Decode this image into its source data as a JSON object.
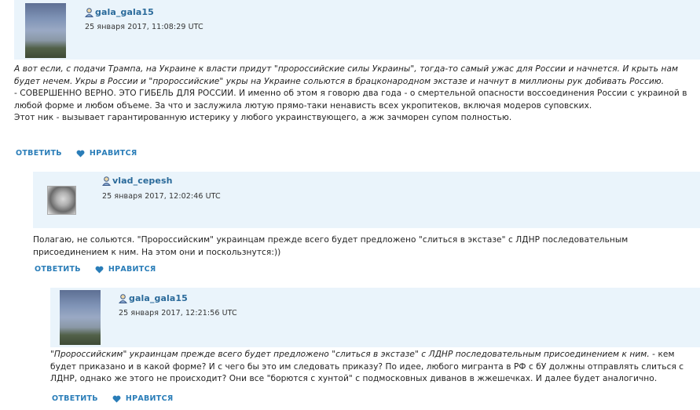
{
  "colors": {
    "header_bg": "#eaf4fb",
    "username": "#2a6a9a",
    "action": "#2a7db8"
  },
  "comments": [
    {
      "username": "gala_gala15",
      "date": "25 января 2017, 11:08:29 UTC",
      "avatar": "sky-photo",
      "paragraphs": [
        {
          "text": "А вот если, с подачи Трампа, на Украине к власти придут \"пророссийские силы Украины\", тогда-то самый ужас для России и начнется. И крыть нам будет нечем. Укры в России и \"пророссийские\" укры на Украине сольются в брацконародном экстазе и начнут в миллионы рук добивать Россию.",
          "italic": true
        },
        {
          "text": "- СОВЕРШЕННО ВЕРНО. ЭТО ГИБЕЛЬ ДЛЯ РОССИИ. И именно об этом я говорю два года - о смертельной опасности воссоединения России с украиной в любой форме и любом объеме. За что и заслужила лютую прямо-таки ненависть всех укропитеков, включая модеров суповских.",
          "italic": false
        },
        {
          "text": "Этот ник - вызывает гарантированную истерику у любого украинствующего, а жж зачморен супом полностью.",
          "italic": false
        }
      ],
      "reply_label": "ОТВЕТИТЬ",
      "like_label": "НРАВИТСЯ"
    },
    {
      "username": "vlad_cepesh",
      "date": "25 января 2017, 12:02:46 UTC",
      "avatar": "portrait-photo",
      "paragraphs": [
        {
          "text": "Полагаю, не сольются. \"Пророссийским\" украинцам прежде всего будет предложено \"слиться в экстазе\" с ЛДНР последовательным присоединением к ним. На этом они и поскользнутся:))",
          "italic": false
        }
      ],
      "reply_label": "ОТВЕТИТЬ",
      "like_label": "НРАВИТСЯ"
    },
    {
      "username": "gala_gala15",
      "date": "25 января 2017, 12:21:56 UTC",
      "avatar": "sky-photo",
      "paragraphs": [
        {
          "text": "\"Пророссийским\" украинцам прежде всего будет предложено \"слиться в экстазе\" с ЛДНР последовательным присоединением к ним.",
          "italic": true
        },
        {
          "text": " - кем будет приказано и в какой форме? И с чего бы это им следовать приказу? По идее, любого мигранта в РФ с бУ должны отправлять слиться с ЛДНР, однако же этого не происходит? Они все \"борются с хунтой\" с подмосковных диванов в жжешечках. И далее будет аналогично.",
          "italic": false,
          "inline": true
        }
      ],
      "reply_label": "ОТВЕТИТЬ",
      "like_label": "НРАВИТСЯ"
    }
  ]
}
